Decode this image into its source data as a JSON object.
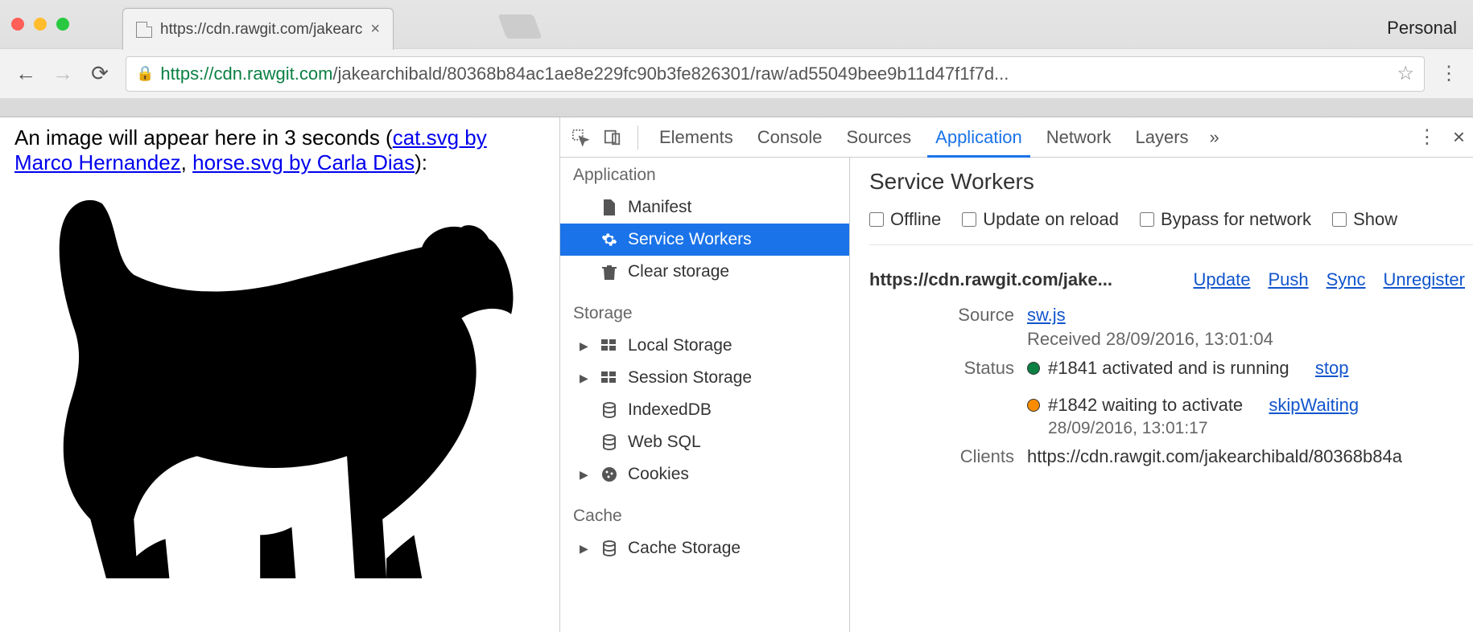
{
  "chrome": {
    "personal_label": "Personal",
    "tab_title": "https://cdn.rawgit.com/jakearc",
    "url_secure": "https",
    "url_host": "://cdn.rawgit.com",
    "url_path": "/jakearchibald/80368b84ac1ae8e229fc90b3fe826301/raw/ad55049bee9b11d47f1f7d..."
  },
  "page": {
    "text_before": "An image will appear here in 3 seconds (",
    "link1": "cat.svg by Marco Hernandez",
    "sep": ", ",
    "link2": "horse.svg by Carla Dias",
    "text_after": "):"
  },
  "devtools": {
    "tabs": [
      "Elements",
      "Console",
      "Sources",
      "Application",
      "Network",
      "Layers"
    ],
    "active_tab": "Application",
    "overflow": "»",
    "sidebar": {
      "groups": [
        {
          "title": "Application",
          "items": [
            {
              "label": "Manifest",
              "icon": "page",
              "disclosure": false,
              "selected": false
            },
            {
              "label": "Service Workers",
              "icon": "gear",
              "disclosure": false,
              "selected": true
            },
            {
              "label": "Clear storage",
              "icon": "trash",
              "disclosure": false,
              "selected": false
            }
          ]
        },
        {
          "title": "Storage",
          "items": [
            {
              "label": "Local Storage",
              "icon": "grid",
              "disclosure": true,
              "selected": false
            },
            {
              "label": "Session Storage",
              "icon": "grid",
              "disclosure": true,
              "selected": false
            },
            {
              "label": "IndexedDB",
              "icon": "db",
              "disclosure": false,
              "selected": false
            },
            {
              "label": "Web SQL",
              "icon": "db",
              "disclosure": false,
              "selected": false
            },
            {
              "label": "Cookies",
              "icon": "cookie",
              "disclosure": true,
              "selected": false
            }
          ]
        },
        {
          "title": "Cache",
          "items": [
            {
              "label": "Cache Storage",
              "icon": "db",
              "disclosure": true,
              "selected": false
            }
          ]
        }
      ]
    },
    "sw": {
      "title": "Service Workers",
      "checks": [
        "Offline",
        "Update on reload",
        "Bypass for network",
        "Show"
      ],
      "origin": "https://cdn.rawgit.com/jake...",
      "actions": [
        "Update",
        "Push",
        "Sync",
        "Unregister"
      ],
      "source_label": "Source",
      "source_link": "sw.js",
      "source_received": "Received 28/09/2016, 13:01:04",
      "status_label": "Status",
      "status1_text": "#1841 activated and is running",
      "status1_action": "stop",
      "status2_text": "#1842 waiting to activate",
      "status2_action": "skipWaiting",
      "status2_time": "28/09/2016, 13:01:17",
      "clients_label": "Clients",
      "clients_value": "https://cdn.rawgit.com/jakearchibald/80368b84a"
    }
  }
}
